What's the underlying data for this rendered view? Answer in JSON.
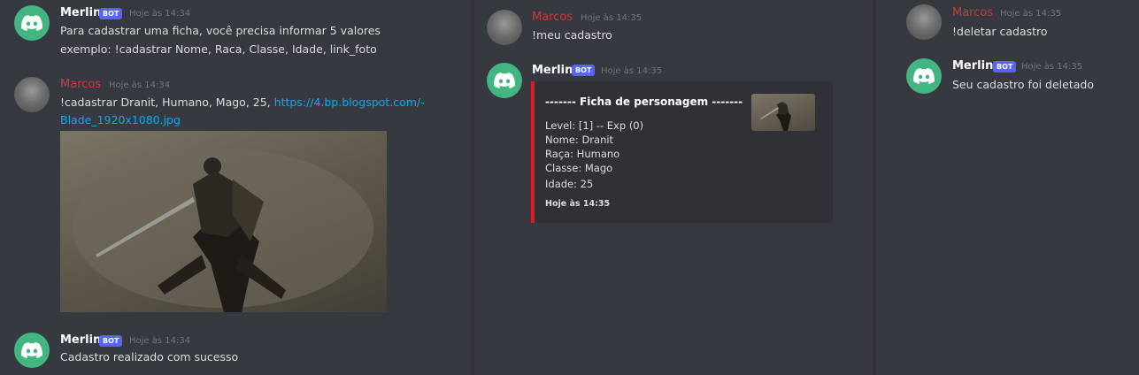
{
  "colors": {
    "background": "#36393f",
    "divider": "#2f3136",
    "bot_avatar": "#43b581",
    "bot_badge": "#5865f2",
    "user_name": "#c83b3b",
    "link": "#00aff4",
    "embed_border": "#e01b24"
  },
  "icons": {
    "bot_avatar": "discord-logo-icon"
  },
  "panel1": {
    "msg1": {
      "author": "Merlin",
      "badge": "BOT",
      "time": "Hoje às 14:34",
      "line1": "Para cadastrar uma ficha, você precisa informar 5 valores",
      "line2": "exemplo: !cadastrar Nome, Raca, Classe, Idade, link_foto"
    },
    "msg2": {
      "author": "Marcos",
      "time": "Hoje às 14:34",
      "text": "!cadastrar Dranit, Humano, Mago, 25, ",
      "link1": "https://4.bp.blogspot.com/-",
      "link2": "Blade_1920x1080.jpg"
    },
    "msg3": {
      "author": "Merlin",
      "badge": "BOT",
      "time": "Hoje às 14:34",
      "text": "Cadastro realizado com sucesso"
    }
  },
  "panel2": {
    "msg1": {
      "author": "Marcos",
      "time": "Hoje às 14:35",
      "text": "!meu cadastro"
    },
    "msg2": {
      "author": "Merlin",
      "badge": "BOT",
      "time": "Hoje às 14:35",
      "embed": {
        "title": "-------  Ficha de personagem  -------",
        "lines": [
          "Level: [1] -- Exp (0)",
          "Nome: Dranit",
          "Raça: Humano",
          "Classe: Mago",
          "Idade: 25"
        ],
        "footer": "Hoje às 14:35"
      }
    }
  },
  "panel3": {
    "msg1": {
      "author": "Marcos",
      "time": "Hoje às 14:35",
      "text": "!deletar cadastro"
    },
    "msg2": {
      "author": "Merlin",
      "badge": "BOT",
      "time": "Hoje às 14:35",
      "text": "Seu cadastro foi deletado"
    }
  }
}
